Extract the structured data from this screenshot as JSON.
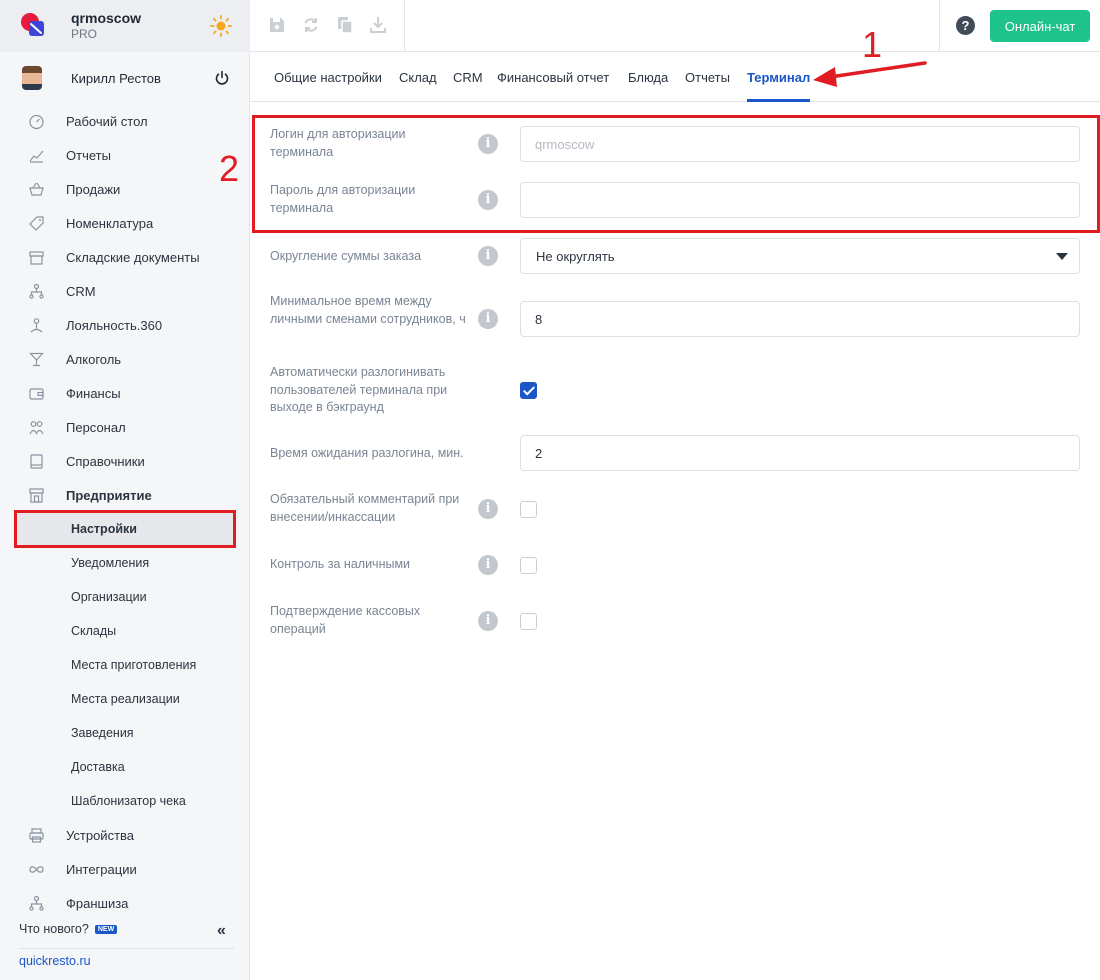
{
  "brand": {
    "name": "qrmoscow",
    "plan": "PRO"
  },
  "user": {
    "name": "Кирилл Рестов"
  },
  "nav": [
    {
      "label": "Рабочий стол",
      "icon": "gauge-icon"
    },
    {
      "label": "Отчеты",
      "icon": "chart-icon"
    },
    {
      "label": "Продажи",
      "icon": "basket-icon"
    },
    {
      "label": "Номенклатура",
      "icon": "tag-icon"
    },
    {
      "label": "Складские документы",
      "icon": "archive-icon"
    },
    {
      "label": "CRM",
      "icon": "org-icon"
    },
    {
      "label": "Лояльность.360",
      "icon": "loyalty-icon"
    },
    {
      "label": "Алкоголь",
      "icon": "glass-icon"
    },
    {
      "label": "Финансы",
      "icon": "wallet-icon"
    },
    {
      "label": "Персонал",
      "icon": "people-icon"
    },
    {
      "label": "Справочники",
      "icon": "book-icon"
    },
    {
      "label": "Предприятие",
      "icon": "store-icon"
    }
  ],
  "subnav": [
    {
      "label": "Настройки"
    },
    {
      "label": "Уведомления"
    },
    {
      "label": "Организации"
    },
    {
      "label": "Склады"
    },
    {
      "label": "Места приготовления"
    },
    {
      "label": "Места реализации"
    },
    {
      "label": "Заведения"
    },
    {
      "label": "Доставка"
    },
    {
      "label": "Шаблонизатор чека"
    }
  ],
  "nav_bottom": [
    {
      "label": "Устройства",
      "icon": "printer-icon"
    },
    {
      "label": "Интеграции",
      "icon": "infinity-icon"
    },
    {
      "label": "Франшиза",
      "icon": "org-icon"
    }
  ],
  "sidebar_footer": {
    "whatsnew": "Что нового?",
    "new_badge": "NEW",
    "site": "quickresto.ru"
  },
  "topbar": {
    "help": "?",
    "chat_button": "Онлайн-чат"
  },
  "tabs": [
    {
      "label": "Общие настройки"
    },
    {
      "label": "Склад"
    },
    {
      "label": "CRM"
    },
    {
      "label": "Финансовый отчет"
    },
    {
      "label": "Блюда"
    },
    {
      "label": "Отчеты"
    },
    {
      "label": "Терминал"
    }
  ],
  "active_tab": "Терминал",
  "form": {
    "login": {
      "label": "Логин для авторизации терминала",
      "placeholder": "qrmoscow",
      "value": ""
    },
    "password": {
      "label": "Пароль для авторизации терминала",
      "value": ""
    },
    "rounding": {
      "label": "Округление суммы заказа",
      "value": "Не округлять"
    },
    "min_shift": {
      "label": "Минимальное время между личными сменами сотрудников, ч",
      "value": "8"
    },
    "auto_logout": {
      "label": "Автоматически разлогинивать пользователей терминала при выходе в бэкграунд",
      "checked": true
    },
    "logout_wait": {
      "label": "Время ожидания разлогина, мин.",
      "value": "2"
    },
    "mandatory_comment": {
      "label": "Обязательный комментарий при внесении/инкассации",
      "checked": false
    },
    "cash_control": {
      "label": "Контроль за наличными",
      "checked": false
    },
    "cash_confirm": {
      "label": "Подтверждение кассовых операций",
      "checked": false
    }
  },
  "annotations": {
    "arrow_number": "1",
    "box_number": "2"
  },
  "colors": {
    "accent": "#1a56c8",
    "chat": "#1ec28b",
    "annotation": "#e11d24"
  }
}
